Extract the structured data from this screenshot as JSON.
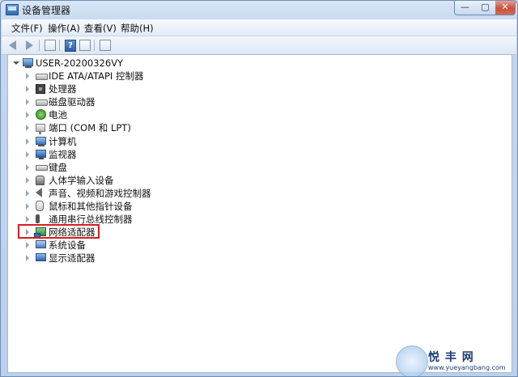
{
  "window": {
    "title": "设备管理器",
    "controls": {
      "minimize": "—",
      "maximize": "▢",
      "close": "✕"
    }
  },
  "menu": {
    "file": "文件(F)",
    "action": "操作(A)",
    "view": "查看(V)",
    "help": "帮助(H)"
  },
  "toolbar": {
    "buttons": [
      "back",
      "forward",
      "properties",
      "help",
      "view",
      "scan-hardware"
    ]
  },
  "tree": {
    "root": "USER-20200326VY",
    "items": [
      {
        "label": "IDE ATA/ATAPI 控制器",
        "icon": "ide-controller-icon"
      },
      {
        "label": "处理器",
        "icon": "processor-icon"
      },
      {
        "label": "磁盘驱动器",
        "icon": "disk-drive-icon"
      },
      {
        "label": "电池",
        "icon": "battery-icon"
      },
      {
        "label": "端口 (COM 和 LPT)",
        "icon": "port-icon"
      },
      {
        "label": "计算机",
        "icon": "computer-icon"
      },
      {
        "label": "监视器",
        "icon": "monitor-icon"
      },
      {
        "label": "键盘",
        "icon": "keyboard-icon"
      },
      {
        "label": "人体学输入设备",
        "icon": "hid-icon"
      },
      {
        "label": "声音、视频和游戏控制器",
        "icon": "sound-icon"
      },
      {
        "label": "鼠标和其他指针设备",
        "icon": "mouse-icon"
      },
      {
        "label": "通用串行总线控制器",
        "icon": "usb-icon"
      },
      {
        "label": "网络适配器",
        "icon": "network-adapter-icon",
        "highlighted": true
      },
      {
        "label": "系统设备",
        "icon": "system-device-icon"
      },
      {
        "label": "显示适配器",
        "icon": "display-adapter-icon"
      }
    ]
  },
  "watermark": {
    "name": "悦 丰 网",
    "url": "www.yueyangbang.com"
  },
  "colors": {
    "highlight_border": "#d02020",
    "title_bar": "#c4d7ee"
  }
}
